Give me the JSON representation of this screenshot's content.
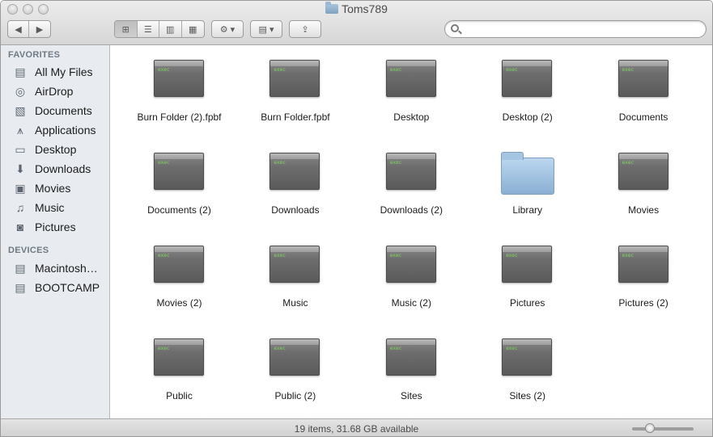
{
  "window": {
    "title": "Toms789"
  },
  "toolbar": {
    "back_icon": "chevron-left-icon",
    "forward_icon": "chevron-right-icon",
    "view_modes": [
      "icon-view",
      "list-view",
      "column-view",
      "coverflow-view"
    ],
    "active_view": "icon-view",
    "action_icon": "gear-icon",
    "arrange_icon": "arrange-grid-icon",
    "share_icon": "share-icon",
    "search_value": "",
    "search_placeholder": ""
  },
  "sidebar": {
    "favorites_header": "FAVORITES",
    "favorites": [
      {
        "label": "All My Files",
        "icon": "all-files-icon"
      },
      {
        "label": "AirDrop",
        "icon": "airdrop-icon"
      },
      {
        "label": "Documents",
        "icon": "documents-icon"
      },
      {
        "label": "Applications",
        "icon": "applications-icon"
      },
      {
        "label": "Desktop",
        "icon": "desktop-icon"
      },
      {
        "label": "Downloads",
        "icon": "downloads-icon"
      },
      {
        "label": "Movies",
        "icon": "movies-icon"
      },
      {
        "label": "Music",
        "icon": "music-icon"
      },
      {
        "label": "Pictures",
        "icon": "camera-icon"
      }
    ],
    "devices_header": "DEVICES",
    "devices": [
      {
        "label": "Macintosh…",
        "icon": "hard-drive-icon"
      },
      {
        "label": "BOOTCAMP",
        "icon": "hard-drive-icon"
      }
    ]
  },
  "items": [
    {
      "label": "Burn Folder (2).fpbf",
      "kind": "exec"
    },
    {
      "label": "Burn Folder.fpbf",
      "kind": "exec"
    },
    {
      "label": "Desktop",
      "kind": "exec"
    },
    {
      "label": "Desktop (2)",
      "kind": "exec"
    },
    {
      "label": "Documents",
      "kind": "exec"
    },
    {
      "label": "Documents (2)",
      "kind": "exec"
    },
    {
      "label": "Downloads",
      "kind": "exec"
    },
    {
      "label": "Downloads (2)",
      "kind": "exec"
    },
    {
      "label": "Library",
      "kind": "folder"
    },
    {
      "label": "Movies",
      "kind": "exec"
    },
    {
      "label": "Movies (2)",
      "kind": "exec"
    },
    {
      "label": "Music",
      "kind": "exec"
    },
    {
      "label": "Music (2)",
      "kind": "exec"
    },
    {
      "label": "Pictures",
      "kind": "exec"
    },
    {
      "label": "Pictures (2)",
      "kind": "exec"
    },
    {
      "label": "Public",
      "kind": "exec"
    },
    {
      "label": "Public (2)",
      "kind": "exec"
    },
    {
      "label": "Sites",
      "kind": "exec"
    },
    {
      "label": "Sites (2)",
      "kind": "exec"
    }
  ],
  "exec_badge": "exec",
  "status": {
    "text": "19 items, 31.68 GB available",
    "zoom_level": 0.25
  }
}
